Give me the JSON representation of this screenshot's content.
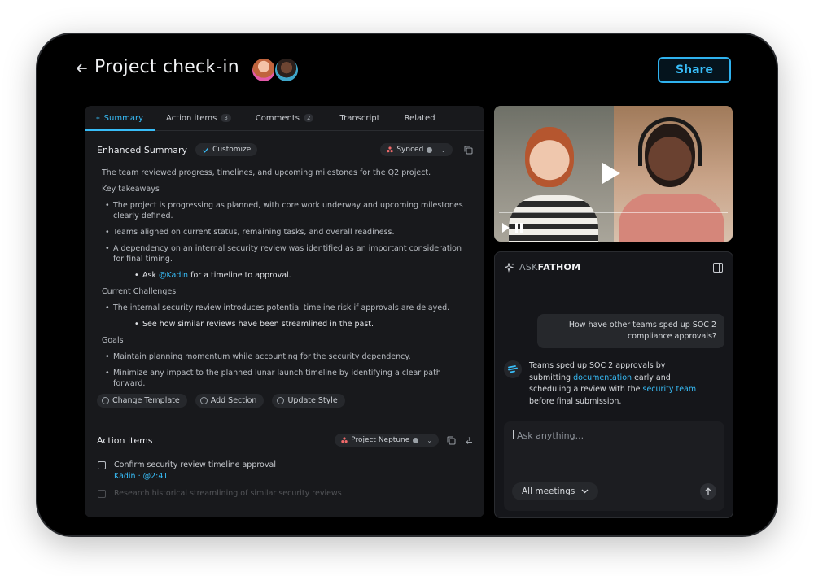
{
  "header": {
    "title": "Project check-in",
    "share_label": "Share"
  },
  "tabs": [
    {
      "label": "Summary"
    },
    {
      "label": "Action items",
      "badge": "3"
    },
    {
      "label": "Comments",
      "badge": "2"
    },
    {
      "label": "Transcript"
    },
    {
      "label": "Related"
    }
  ],
  "summary": {
    "title": "Enhanced Summary",
    "customize_label": "Customize",
    "synced_label": "Synced",
    "intro": "The team reviewed progress, timelines, and upcoming milestones for the Q2 project.",
    "key_takeaways_heading": "Key takeaways",
    "takeaways": [
      "The project is progressing as planned, with core work underway and upcoming milestones clearly defined.",
      "Teams aligned on current status, remaining tasks, and overall readiness.",
      "A dependency on an internal security review was identified as an important consideration for final timing."
    ],
    "ask_prefix": "Ask",
    "ask_mention": "@Kadin",
    "ask_suffix": "for a timeline to approval.",
    "challenges_heading": "Current Challenges",
    "challenges": [
      "The internal security review introduces potential timeline risk if approvals are delayed."
    ],
    "challenge_sub": "See how similar reviews have been streamlined in the past.",
    "goals_heading": "Goals",
    "goals": [
      "Maintain planning momentum while accounting for the security dependency.",
      "Minimize any impact to the planned lunar launch timeline by identifying a clear path forward."
    ],
    "actions": [
      "Change Template",
      "Add Section",
      "Update Style"
    ]
  },
  "action_items": {
    "title": "Action items",
    "project_label": "Project Neptune",
    "tasks": [
      {
        "text": "Confirm security review timeline approval",
        "meta": "Kadin · @2:41"
      },
      {
        "text": "Research historical streamlining of similar security reviews",
        "meta": ""
      }
    ]
  },
  "ask": {
    "label_dim": "ASK",
    "label_bright": "FATHOM",
    "user_message": "How have other teams sped up SOC 2 compliance approvals?",
    "reply_1": "Teams sped up SOC 2 approvals by submitting",
    "reply_link_1": "documentation",
    "reply_2": "early and scheduling a review with the",
    "reply_link_2": "security team",
    "reply_3": "before final submission.",
    "input_placeholder": "Ask anything...",
    "scope_label": "All meetings"
  },
  "colors": {
    "accent": "#38bdf8",
    "background": "#000000",
    "panel": "#18191c"
  }
}
